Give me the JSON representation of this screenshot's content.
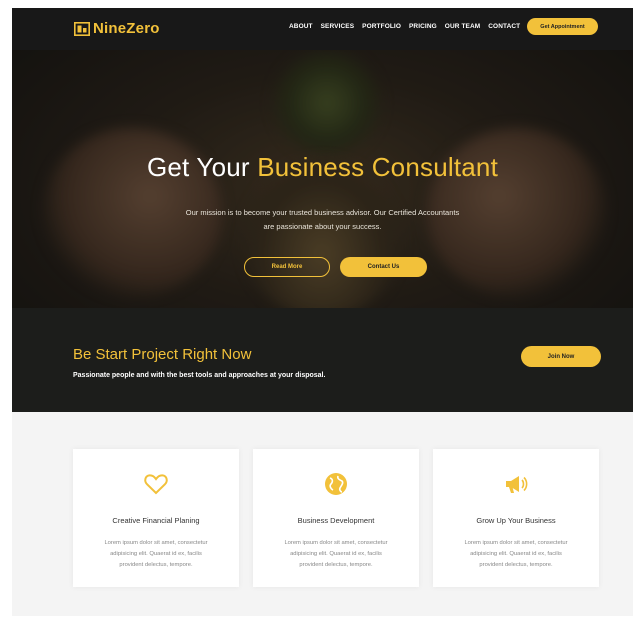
{
  "brand": {
    "name": "NineZero",
    "accent": "#f2c13a"
  },
  "nav": {
    "items": [
      "ABOUT",
      "SERVICES",
      "PORTFOLIO",
      "PRICING",
      "OUR TEAM",
      "CONTACT"
    ],
    "cta": "Get Appointment"
  },
  "hero": {
    "title_plain": "Get Your ",
    "title_highlight": "Business Consultant",
    "subtitle_line1": "Our mission is to become your trusted business advisor. Our Certified Accountants",
    "subtitle_line2": "are passionate about your success.",
    "read_more": "Read More",
    "contact_us": "Contact Us"
  },
  "band": {
    "title": "Be Start Project Right Now",
    "subtitle": "Passionate people and with the best tools and approaches at your disposal.",
    "cta": "Join Now"
  },
  "features": [
    {
      "icon": "heart-icon",
      "title": "Creative Financial Planing",
      "line1": "Lorem ipsum dolor sit amet, consectetur",
      "line2": "adipisicing elit. Quaerat id ex, facilis",
      "line3": "provident delectus, tempore."
    },
    {
      "icon": "globe-icon",
      "title": "Business Development",
      "line1": "Lorem ipsum dolor sit amet, consectetur",
      "line2": "adipisicing elit. Quaerat id ex, facilis",
      "line3": "provident delectus, tempore."
    },
    {
      "icon": "megaphone-icon",
      "title": "Grow Up Your Business",
      "line1": "Lorem ipsum dolor sit amet, consectetur",
      "line2": "adipisicing elit. Quaerat id ex, facilis",
      "line3": "provident delectus, tempore."
    }
  ]
}
